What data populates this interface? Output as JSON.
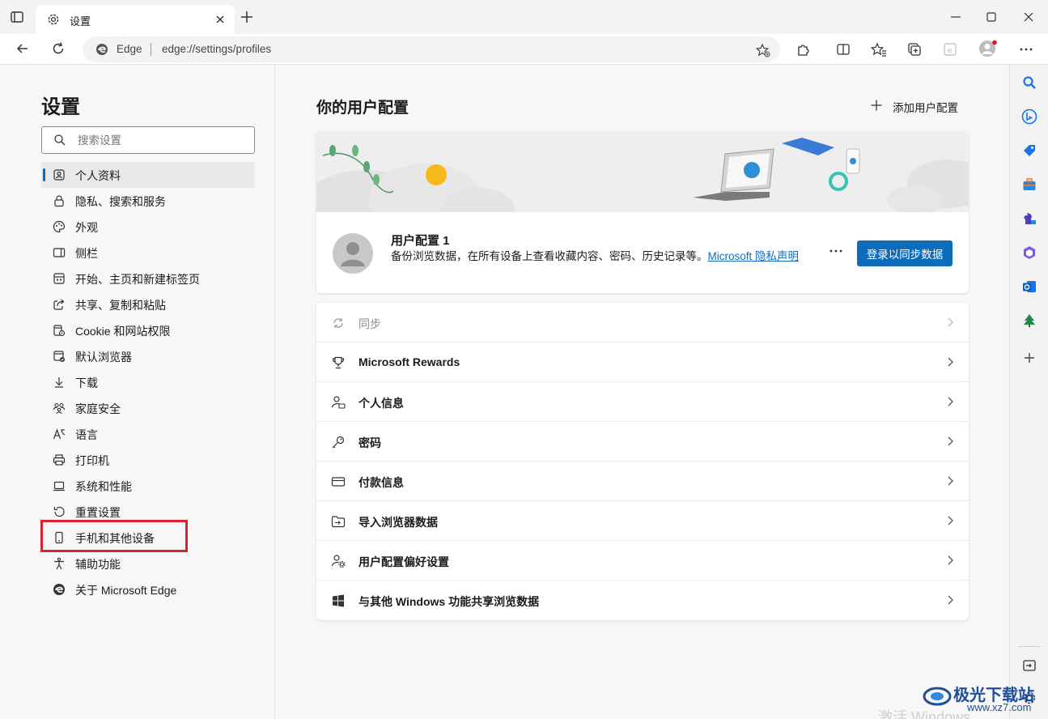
{
  "tab": {
    "title": "设置"
  },
  "address": {
    "site": "Edge",
    "url": "edge://settings/profiles"
  },
  "sidebar": {
    "title": "设置",
    "search_placeholder": "搜索设置",
    "items": [
      {
        "label": "个人资料",
        "icon": "profile-icon",
        "active": true
      },
      {
        "label": "隐私、搜索和服务",
        "icon": "lock-icon"
      },
      {
        "label": "外观",
        "icon": "palette-icon"
      },
      {
        "label": "侧栏",
        "icon": "sidebar-panel-icon"
      },
      {
        "label": "开始、主页和新建标签页",
        "icon": "home-grid-icon"
      },
      {
        "label": "共享、复制和粘贴",
        "icon": "share-icon"
      },
      {
        "label": "Cookie 和网站权限",
        "icon": "cookie-icon"
      },
      {
        "label": "默认浏览器",
        "icon": "browser-icon"
      },
      {
        "label": "下载",
        "icon": "download-icon"
      },
      {
        "label": "家庭安全",
        "icon": "family-icon"
      },
      {
        "label": "语言",
        "icon": "language-icon"
      },
      {
        "label": "打印机",
        "icon": "printer-icon"
      },
      {
        "label": "系统和性能",
        "icon": "laptop-icon"
      },
      {
        "label": "重置设置",
        "icon": "reset-icon"
      },
      {
        "label": "手机和其他设备",
        "icon": "phone-icon"
      },
      {
        "label": "辅助功能",
        "icon": "accessibility-icon"
      },
      {
        "label": "关于 Microsoft Edge",
        "icon": "edge-logo-icon"
      }
    ]
  },
  "main": {
    "title": "你的用户配置",
    "add_profile": "添加用户配置",
    "profile": {
      "name": "用户配置 1",
      "desc_prefix": "备份浏览数据，在所有设备上查看收藏内容、密码、历史记录等。",
      "link_text": "Microsoft 隐私声明",
      "sync_button": "登录以同步数据"
    },
    "rows": [
      {
        "label": "同步",
        "icon": "sync-icon",
        "disabled": true
      },
      {
        "label": "Microsoft Rewards",
        "icon": "trophy-icon"
      },
      {
        "label": "个人信息",
        "icon": "person-card-icon"
      },
      {
        "label": "密码",
        "icon": "key-icon"
      },
      {
        "label": "付款信息",
        "icon": "credit-card-icon"
      },
      {
        "label": "导入浏览器数据",
        "icon": "import-icon"
      },
      {
        "label": "用户配置偏好设置",
        "icon": "profile-gear-icon"
      },
      {
        "label": "与其他 Windows 功能共享浏览数据",
        "icon": "windows-icon"
      }
    ]
  },
  "watermark": {
    "brand": "极光下载站",
    "url": "www.xz7.com",
    "activate": "激活 Windows"
  },
  "colors": {
    "accent": "#0f6cbd",
    "highlight": "#d9232e"
  }
}
